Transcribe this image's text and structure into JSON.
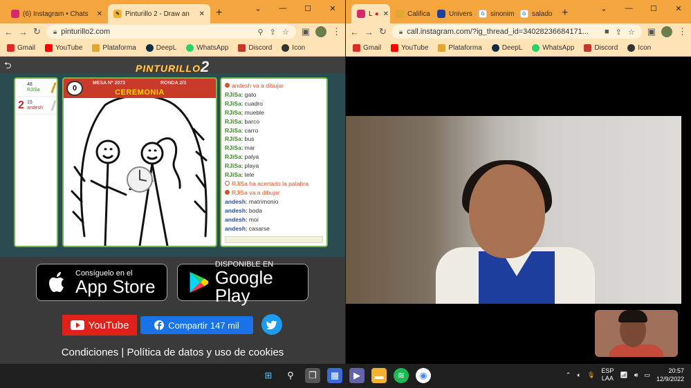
{
  "left_window": {
    "tabs": [
      {
        "title": "(6) Instagram • Chats",
        "icon": "instagram-icon",
        "active": false
      },
      {
        "title": "Pinturillo 2 - Draw an",
        "icon": "pinturillo-icon",
        "active": true
      }
    ],
    "url": "pinturillo2.com",
    "bookmarks": [
      "Gmail",
      "YouTube",
      "Plataforma",
      "DeepL",
      "WhatsApp",
      "Discord",
      "Icon"
    ]
  },
  "right_window": {
    "tabs": [
      {
        "title": "L",
        "icon": "instagram-icon",
        "active": true
      },
      {
        "title": "Califica",
        "icon": "grade-icon",
        "active": false
      },
      {
        "title": "Univers",
        "icon": "university-icon",
        "active": false
      },
      {
        "title": "sinonim",
        "icon": "google-icon",
        "active": false
      },
      {
        "title": "salado",
        "icon": "google-icon",
        "active": false
      }
    ],
    "url": "call.instagram.com/?ig_thread_id=34028236684171...",
    "bookmarks": [
      "Gmail",
      "YouTube",
      "Plataforma",
      "DeepL",
      "WhatsApp",
      "Discord",
      "Icon"
    ]
  },
  "game": {
    "logo_text": "PINTURILLO",
    "logo_number": "2",
    "players": [
      {
        "rank": "",
        "score": "48",
        "name": "RJiSa",
        "name_color": "#3b8a25"
      },
      {
        "rank": "2",
        "score": "15",
        "name": "andesh",
        "name_color": "#d02020"
      }
    ],
    "timer": "0",
    "mesa": "MESA Nº 2073",
    "ronda": "RONDA 2/3",
    "word": "CEREMONIA",
    "chat": [
      {
        "type": "sys",
        "text": "andesh va a dibujar"
      },
      {
        "type": "msg",
        "who": "RJiSa",
        "text": "gato"
      },
      {
        "type": "msg",
        "who": "RJiSa",
        "text": "cuadro"
      },
      {
        "type": "msg",
        "who": "RJiSa",
        "text": "mueble"
      },
      {
        "type": "msg",
        "who": "RJiSa",
        "text": "barco"
      },
      {
        "type": "msg",
        "who": "RJiSa",
        "text": "carro"
      },
      {
        "type": "msg",
        "who": "RJiSa",
        "text": "bus"
      },
      {
        "type": "msg",
        "who": "RJiSa",
        "text": "mar"
      },
      {
        "type": "msg",
        "who": "RJiSa",
        "text": "palya"
      },
      {
        "type": "msg",
        "who": "RJiSa",
        "text": "playa"
      },
      {
        "type": "msg",
        "who": "RJiSa",
        "text": "tele"
      },
      {
        "type": "sys2",
        "text": "RJiSa ha acertado la palabra"
      },
      {
        "type": "sys",
        "text": "RJiSa va a dibujar"
      },
      {
        "type": "msg2",
        "who": "andesh",
        "text": "matrimonio"
      },
      {
        "type": "msg2",
        "who": "andesh",
        "text": "boda"
      },
      {
        "type": "msg2",
        "who": "andesh",
        "text": "moi"
      },
      {
        "type": "msg2",
        "who": "andesh",
        "text": "casarse"
      }
    ],
    "app_store": {
      "small": "Consíguelo en el",
      "big": "App Store"
    },
    "google_play": {
      "small": "DISPONIBLE EN",
      "big": "Google Play"
    },
    "youtube_label": "YouTube",
    "facebook_label": "Compartir 147 mil",
    "footer": "Condiciones | Política de datos y uso de cookies"
  },
  "taskbar": {
    "lang": "ESP",
    "layout": "LAA",
    "time": "20:57",
    "date": "12/9/2022"
  }
}
